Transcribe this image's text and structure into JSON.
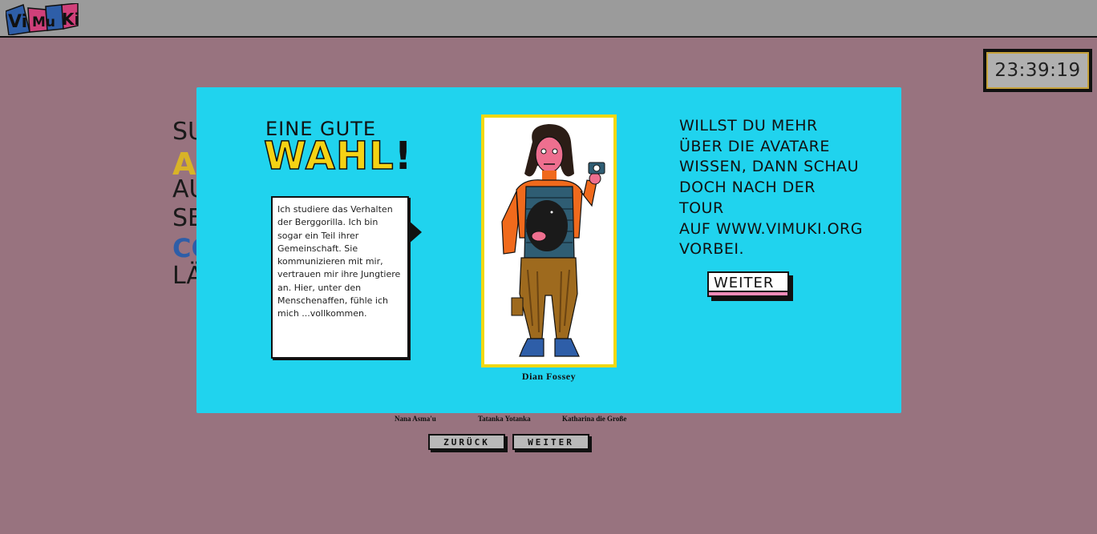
{
  "app": {
    "logo_text": "ViMuKi",
    "timer": "23:39:19"
  },
  "background": {
    "headline_lines": [
      "SU",
      "A",
      "AU",
      "SE",
      "CO",
      "LÄ"
    ],
    "avatars": [
      "Nana Asma'u",
      "Tatanka Yotanka",
      "Katharina die Große"
    ],
    "back_label": "ZURÜCK",
    "next_label": "WEITER"
  },
  "modal": {
    "title_small": "EINE GUTE",
    "title_big": "WAHL",
    "title_bang": "!",
    "speech": "Ich studiere das Verhalten der Berggorilla. Ich bin sogar ein Teil ihrer Gemeinschaft. Sie kommunizieren mit mir, vertrauen mir ihre Jungtiere an. Hier, unter den Menschenaffen, fühle ich mich ...vollkommen.",
    "avatar_name": "Dian Fossey",
    "info_lines": [
      "WILLST DU MEHR",
      "ÜBER DIE AVATARE",
      "WISSEN, DANN SCHAU",
      "DOCH NACH DER TOUR",
      "AUF WWW.VIMUKI.ORG",
      "VORBEI."
    ],
    "next_label": "WEITER"
  },
  "colors": {
    "page_bg": "#98737f",
    "topbar": "#9b9b9b",
    "modal_bg": "#20d3ee",
    "frame": "#f2d813",
    "accent_pink": "#f08ab8",
    "logo_blue": "#2e5ea8",
    "logo_pink": "#d0407a"
  }
}
